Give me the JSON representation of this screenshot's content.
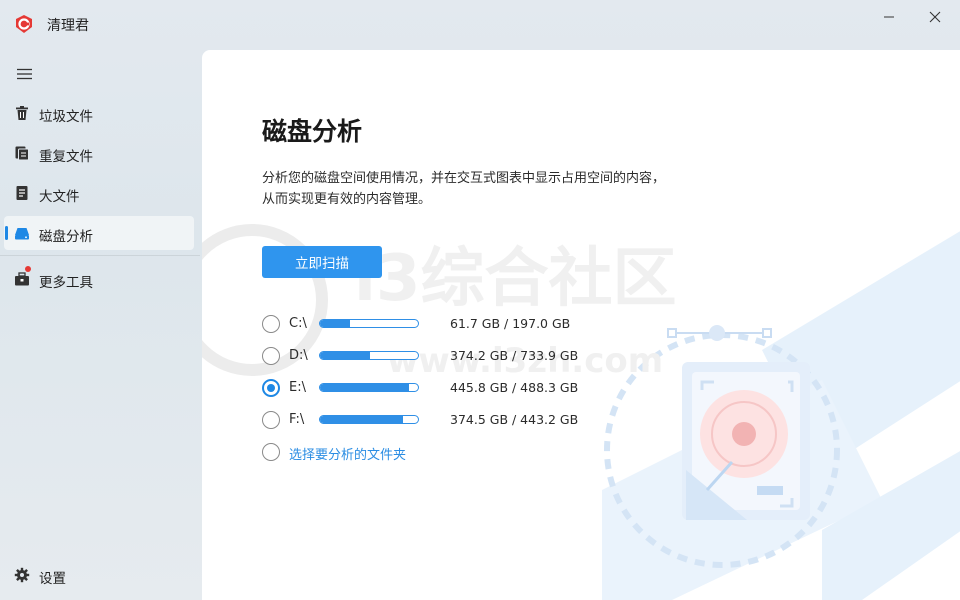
{
  "app": {
    "title": "清理君",
    "brand_color": "#e53935"
  },
  "window_controls": {
    "minimize_icon": "minimize-icon",
    "close_icon": "close-icon"
  },
  "sidebar": {
    "menu_icon": "hamburger-icon",
    "items": [
      {
        "label": "垃圾文件",
        "icon": "trash-icon",
        "active": false
      },
      {
        "label": "重复文件",
        "icon": "duplicate-files-icon",
        "active": false
      },
      {
        "label": "大文件",
        "icon": "large-file-icon",
        "active": false
      },
      {
        "label": "磁盘分析",
        "icon": "disk-icon",
        "active": true
      },
      {
        "label": "更多工具",
        "icon": "toolbox-icon",
        "active": false,
        "badge": true
      }
    ],
    "settings_label": "设置"
  },
  "main": {
    "title": "磁盘分析",
    "description_line1": "分析您的磁盘空间使用情况，并在交互式图表中显示占用空间的内容，",
    "description_line2": "从而实现更有效的内容管理。",
    "scan_button": "立即扫描",
    "drives": [
      {
        "name": "C:\\",
        "usage": "61.7 GB / 197.0 GB",
        "used_fraction": 0.31,
        "selected": false
      },
      {
        "name": "D:\\",
        "usage": "374.2 GB / 733.9 GB",
        "used_fraction": 0.51,
        "selected": false
      },
      {
        "name": "E:\\",
        "usage": "445.8 GB / 488.3 GB",
        "used_fraction": 0.91,
        "selected": true
      },
      {
        "name": "F:\\",
        "usage": "374.5 GB / 443.2 GB",
        "used_fraction": 0.845,
        "selected": false
      }
    ],
    "choose_folder": "选择要分析的文件夹"
  },
  "watermark": {
    "text_cn": "i3综合社区",
    "text_url": "www.i3zh.com"
  },
  "colors": {
    "accent": "#2f95ee",
    "link": "#2b8de3"
  }
}
